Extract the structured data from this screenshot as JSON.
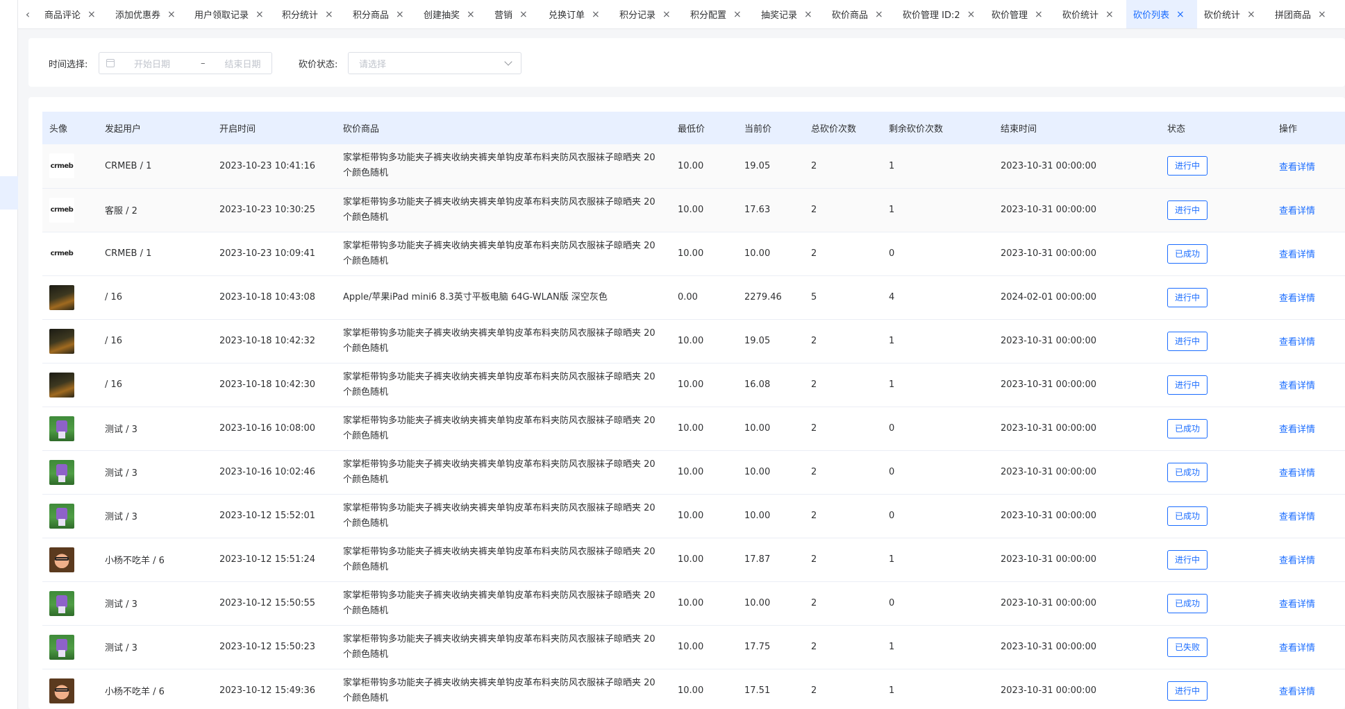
{
  "tabbar": {
    "prev_arrow": "‹",
    "tabs": [
      {
        "label": "商品评论",
        "close": "×",
        "width": 102
      },
      {
        "label": "添加优惠券",
        "close": "×",
        "width": 114
      },
      {
        "label": "用户领取记录",
        "close": "×",
        "width": 126
      },
      {
        "label": "积分统计",
        "close": "×",
        "width": 102
      },
      {
        "label": "积分商品",
        "close": "×",
        "width": 102
      },
      {
        "label": "创建抽奖",
        "close": "×",
        "width": 102
      },
      {
        "label": "营销",
        "close": "×",
        "width": 78
      },
      {
        "label": "兑换订单",
        "close": "×",
        "width": 102
      },
      {
        "label": "积分记录",
        "close": "×",
        "width": 102
      },
      {
        "label": "积分配置",
        "close": "×",
        "width": 102
      },
      {
        "label": "抽奖记录",
        "close": "×",
        "width": 102
      },
      {
        "label": "砍价商品",
        "close": "×",
        "width": 102
      },
      {
        "label": "砍价管理 ID:2",
        "close": "×",
        "width": 128
      },
      {
        "label": "砍价管理",
        "close": "×",
        "width": 102
      },
      {
        "label": "砍价统计",
        "close": "×",
        "width": 102
      },
      {
        "label": "砍价列表",
        "close": "×",
        "width": 102,
        "active": true
      },
      {
        "label": "砍价统计",
        "close": "×",
        "width": 102
      },
      {
        "label": "拼团商品",
        "close": "×",
        "width": 102
      }
    ]
  },
  "filters": {
    "time_label": "时间选择:",
    "start_placeholder": "开始日期",
    "separator": "–",
    "end_placeholder": "结束日期",
    "status_label": "砍价状态:",
    "status_placeholder": "请选择"
  },
  "table": {
    "columns": [
      "头像",
      "发起用户",
      "开启时间",
      "砍价商品",
      "最低价",
      "当前价",
      "总砍价次数",
      "剩余砍价次数",
      "结束时间",
      "状态",
      "操作"
    ],
    "rows": [
      {
        "avatar": "crmeb-logo",
        "user": "CRMEB / 1",
        "start": "2023-10-23 10:41:16",
        "product": "家掌柜带钩多功能夹子裤夹收纳夹裤夹单钩皮革布料夹防风衣服袜子晾晒夹 20个颜色随机",
        "min_price": "10.00",
        "cur_price": "19.05",
        "total": "2",
        "remain": "1",
        "end": "2023-10-31 00:00:00",
        "status": "进行中",
        "action": "查看详情"
      },
      {
        "avatar": "crmeb-logo",
        "user": "客服 / 2",
        "start": "2023-10-23 10:30:25",
        "product": "家掌柜带钩多功能夹子裤夹收纳夹裤夹单钩皮革布料夹防风衣服袜子晾晒夹 20个颜色随机",
        "min_price": "10.00",
        "cur_price": "17.63",
        "total": "2",
        "remain": "1",
        "end": "2023-10-31 00:00:00",
        "status": "进行中",
        "action": "查看详情"
      },
      {
        "avatar": "crmeb-logo",
        "user": "CRMEB / 1",
        "start": "2023-10-23 10:09:41",
        "product": "家掌柜带钩多功能夹子裤夹收纳夹裤夹单钩皮革布料夹防风衣服袜子晾晒夹 20个颜色随机",
        "min_price": "10.00",
        "cur_price": "10.00",
        "total": "2",
        "remain": "0",
        "end": "2023-10-31 00:00:00",
        "status": "已成功",
        "action": "查看详情"
      },
      {
        "avatar": "night-photo",
        "user": " / 16",
        "start": "2023-10-18 10:43:08",
        "product": "Apple/苹果iPad mini6 8.3英寸平板电脑 64G-WLAN版 深空灰色",
        "min_price": "0.00",
        "cur_price": "2279.46",
        "total": "5",
        "remain": "4",
        "end": "2024-02-01 00:00:00",
        "status": "进行中",
        "action": "查看详情"
      },
      {
        "avatar": "night-photo",
        "user": " / 16",
        "start": "2023-10-18 10:42:32",
        "product": "家掌柜带钩多功能夹子裤夹收纳夹裤夹单钩皮革布料夹防风衣服袜子晾晒夹 20个颜色随机",
        "min_price": "10.00",
        "cur_price": "19.05",
        "total": "2",
        "remain": "1",
        "end": "2023-10-31 00:00:00",
        "status": "进行中",
        "action": "查看详情"
      },
      {
        "avatar": "night-photo",
        "user": " / 16",
        "start": "2023-10-18 10:42:30",
        "product": "家掌柜带钩多功能夹子裤夹收纳夹裤夹单钩皮革布料夹防风衣服袜子晾晒夹 20个颜色随机",
        "min_price": "10.00",
        "cur_price": "16.08",
        "total": "2",
        "remain": "1",
        "end": "2023-10-31 00:00:00",
        "status": "进行中",
        "action": "查看详情"
      },
      {
        "avatar": "pixel-character",
        "user": "测试 / 3",
        "start": "2023-10-16 10:08:00",
        "product": "家掌柜带钩多功能夹子裤夹收纳夹裤夹单钩皮革布料夹防风衣服袜子晾晒夹 20个颜色随机",
        "min_price": "10.00",
        "cur_price": "10.00",
        "total": "2",
        "remain": "0",
        "end": "2023-10-31 00:00:00",
        "status": "已成功",
        "action": "查看详情"
      },
      {
        "avatar": "pixel-character",
        "user": "测试 / 3",
        "start": "2023-10-16 10:02:46",
        "product": "家掌柜带钩多功能夹子裤夹收纳夹裤夹单钩皮革布料夹防风衣服袜子晾晒夹 20个颜色随机",
        "min_price": "10.00",
        "cur_price": "10.00",
        "total": "2",
        "remain": "0",
        "end": "2023-10-31 00:00:00",
        "status": "已成功",
        "action": "查看详情"
      },
      {
        "avatar": "pixel-character",
        "user": "测试 / 3",
        "start": "2023-10-12 15:52:01",
        "product": "家掌柜带钩多功能夹子裤夹收纳夹裤夹单钩皮革布料夹防风衣服袜子晾晒夹 20个颜色随机",
        "min_price": "10.00",
        "cur_price": "10.00",
        "total": "2",
        "remain": "0",
        "end": "2023-10-31 00:00:00",
        "status": "已成功",
        "action": "查看详情"
      },
      {
        "avatar": "cartoon-face",
        "user": "小杨不吃羊 / 6",
        "start": "2023-10-12 15:51:24",
        "product": "家掌柜带钩多功能夹子裤夹收纳夹裤夹单钩皮革布料夹防风衣服袜子晾晒夹 20个颜色随机",
        "min_price": "10.00",
        "cur_price": "17.87",
        "total": "2",
        "remain": "1",
        "end": "2023-10-31 00:00:00",
        "status": "进行中",
        "action": "查看详情"
      },
      {
        "avatar": "pixel-character",
        "user": "测试 / 3",
        "start": "2023-10-12 15:50:55",
        "product": "家掌柜带钩多功能夹子裤夹收纳夹裤夹单钩皮革布料夹防风衣服袜子晾晒夹 20个颜色随机",
        "min_price": "10.00",
        "cur_price": "10.00",
        "total": "2",
        "remain": "0",
        "end": "2023-10-31 00:00:00",
        "status": "已成功",
        "action": "查看详情"
      },
      {
        "avatar": "pixel-character",
        "user": "测试 / 3",
        "start": "2023-10-12 15:50:23",
        "product": "家掌柜带钩多功能夹子裤夹收纳夹裤夹单钩皮革布料夹防风衣服袜子晾晒夹 20个颜色随机",
        "min_price": "10.00",
        "cur_price": "17.75",
        "total": "2",
        "remain": "1",
        "end": "2023-10-31 00:00:00",
        "status": "已失败",
        "action": "查看详情"
      },
      {
        "avatar": "cartoon-face",
        "user": "小杨不吃羊 / 6",
        "start": "2023-10-12 15:49:36",
        "product": "家掌柜带钩多功能夹子裤夹收纳夹裤夹单钩皮革布料夹防风衣服袜子晾晒夹 20个颜色随机",
        "min_price": "10.00",
        "cur_price": "17.51",
        "total": "2",
        "remain": "1",
        "end": "2023-10-31 00:00:00",
        "status": "进行中",
        "action": "查看详情"
      }
    ]
  },
  "colors": {
    "accent": "#1a6cff",
    "header_bg": "#e8f0ff",
    "page_bg": "#f5f6f8"
  }
}
